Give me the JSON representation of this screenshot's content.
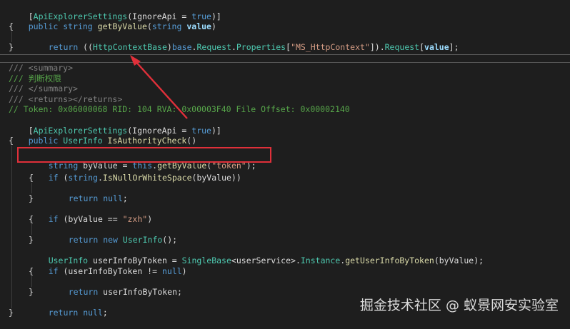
{
  "code": {
    "l1": {
      "a": "[",
      "b": "ApiExplorerSettings",
      "c": "(",
      "d": "IgnoreApi",
      "e": " = ",
      "f": "true",
      "g": ")]"
    },
    "l2": {
      "a": "public",
      "b": " ",
      "c": "string",
      "d": " ",
      "e": "getByValue",
      "f": "(",
      "g": "string",
      "h": " ",
      "i": "value",
      "j": ")"
    },
    "l3": "{",
    "l4": {
      "a": "return",
      "b": " ((",
      "c": "HttpContextBase",
      "d": ")",
      "e": "base",
      "f": ".",
      "g": "Request",
      "h": ".",
      "i": "Properties",
      "j": "[",
      "k": "\"MS_HttpContext\"",
      "l": "]).",
      "m": "Request",
      "n": "[",
      "o": "value",
      "p": "];"
    },
    "l5": "}",
    "c1": "/// <summary>",
    "c2": "/// 判断权限",
    "c3": "/// </summary>",
    "c4": "/// <returns></returns>",
    "c5": "// Token: 0x06000068 RID: 104 RVA: 0x00003F40 File Offset: 0x00002140",
    "m1": {
      "a": "[",
      "b": "ApiExplorerSettings",
      "c": "(",
      "d": "IgnoreApi",
      "e": " = ",
      "f": "true",
      "g": ")]"
    },
    "m2": {
      "a": "public",
      "b": " ",
      "c": "UserInfo",
      "d": " ",
      "e": "IsAuthorityCheck",
      "f": "()"
    },
    "m3": "{",
    "m4": {
      "a": "string",
      "b": " byValue = ",
      "c": "this",
      "d": ".",
      "e": "getByValue",
      "f": "(",
      "g": "\"token\"",
      "h": ");"
    },
    "m5": {
      "a": "if",
      "b": " (",
      "c": "string",
      "d": ".",
      "e": "IsNullOrWhiteSpace",
      "f": "(byValue))"
    },
    "m6": "{",
    "m7": {
      "a": "return",
      "b": " ",
      "c": "null",
      "d": ";"
    },
    "m8": "}",
    "m9": {
      "a": "if",
      "b": " (byValue == ",
      "c": "\"zxh\"",
      "d": ")"
    },
    "m10": "{",
    "m11": {
      "a": "return",
      "b": " ",
      "c": "new",
      "d": " ",
      "e": "UserInfo",
      "f": "();"
    },
    "m12": "}",
    "m13": {
      "a": "UserInfo",
      "b": " userInfoByToken = ",
      "c": "SingleBase",
      "d": "<",
      "e": "userService",
      "f": ">.",
      "g": "Instance",
      "h": ".",
      "i": "getUserInfoByToken",
      "j": "(byValue);"
    },
    "m14": {
      "a": "if",
      "b": " (userInfoByToken != ",
      "c": "null",
      "d": ")"
    },
    "m15": "{",
    "m16": {
      "a": "return",
      "b": " userInfoByToken;"
    },
    "m17": "}",
    "m18": {
      "a": "return",
      "b": " ",
      "c": "null",
      "d": ";"
    },
    "m19": "}"
  },
  "watermark": "掘金技术社区 @ 蚁景网安实验室",
  "colors": {
    "background": "#1e1e1e",
    "keyword": "#569cd6",
    "type": "#4ec9b0",
    "method": "#dcdcaa",
    "string": "#d69d85",
    "comment": "#57a64a",
    "highlight": "#e0303a"
  }
}
